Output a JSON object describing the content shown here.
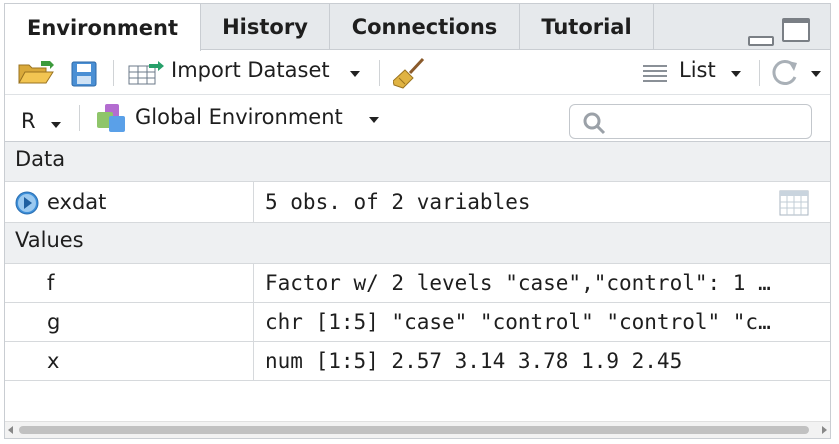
{
  "tabs": [
    {
      "label": "Environment",
      "active": true
    },
    {
      "label": "History",
      "active": false
    },
    {
      "label": "Connections",
      "active": false
    },
    {
      "label": "Tutorial",
      "active": false
    }
  ],
  "toolbar": {
    "import_label": "Import Dataset",
    "view_mode": "List"
  },
  "toolbar2": {
    "language": "R",
    "environment": "Global Environment",
    "search_placeholder": ""
  },
  "sections": {
    "data": "Data",
    "values": "Values"
  },
  "data_rows": [
    {
      "name": "exdat",
      "value": "5 obs. of 2 variables"
    }
  ],
  "value_rows": [
    {
      "name": "f",
      "value": "Factor w/ 2 levels \"case\",\"control\": 1 …"
    },
    {
      "name": "g",
      "value": "chr [1:5] \"case\" \"control\" \"control\" \"c…"
    },
    {
      "name": "x",
      "value": "num [1:5] 2.57 3.14 3.78 1.9 2.45"
    }
  ],
  "colors": {
    "accent_blue": "#3d8fd8",
    "tab_bg": "#e6e9ec",
    "border": "#c9cdd2"
  }
}
